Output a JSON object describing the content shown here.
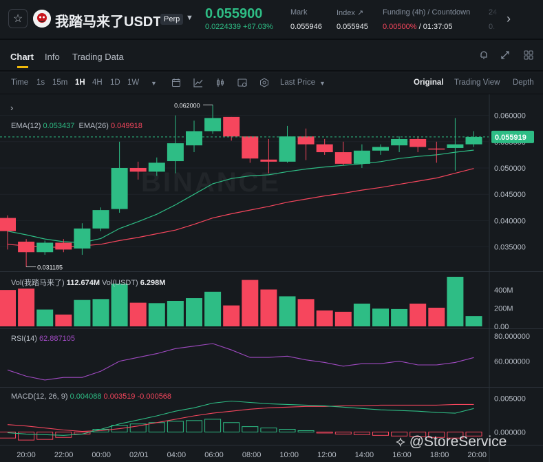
{
  "header": {
    "star_icon": "star-icon",
    "symbol": "我踏马来了USDT",
    "contract_badge": "Perp",
    "last_price": "0.055900",
    "change": "0.0224339 +67.03%",
    "stats": [
      {
        "label": "Mark",
        "value": "0.055946"
      },
      {
        "label": "Index ↗",
        "value": "0.055945"
      },
      {
        "label": "Funding (4h) / Countdown",
        "value_rate": "0.00500%",
        "value_countdown": " / 01:37:05"
      },
      {
        "label": "24",
        "value": "0."
      }
    ],
    "colors": {
      "up": "#2ebd85",
      "down": "#f6465d",
      "accent": "#f0b90b"
    }
  },
  "tabs": {
    "items": [
      "Chart",
      "Info",
      "Trading Data"
    ],
    "active": "Chart"
  },
  "toolbar": {
    "time_label": "Time",
    "intervals": [
      "1s",
      "15m",
      "1H",
      "4H",
      "1D",
      "1W"
    ],
    "active_interval": "1H",
    "price_type": "Last Price",
    "views": [
      "Original",
      "Trading View",
      "Depth"
    ],
    "active_view": "Original"
  },
  "chart": {
    "watermark": "BINANCE",
    "ema_legend": {
      "ema12_label": "EMA(12)",
      "ema12_value": "0.053437",
      "ema26_label": "EMA(26)",
      "ema26_value": "0.049918"
    },
    "vol_legend": {
      "label1": "Vol(我踏马来了)",
      "value1": "112.674M",
      "label2": "Vol(USDT)",
      "value2": "6.298M"
    },
    "rsi_legend": {
      "label": "RSI(14)",
      "value": "62.887105"
    },
    "macd_legend": {
      "label": "MACD(12, 26, 9)",
      "v1": "0.004088",
      "v2": "0.003519",
      "v3": "-0.000568"
    },
    "price_axis": [
      "0.060000",
      "0.055000",
      "0.050000",
      "0.045000",
      "0.040000",
      "0.035000"
    ],
    "current_price_tag": "0.055919",
    "high_label": "0.062000",
    "low_label": "0.031185",
    "vol_axis": [
      "400M",
      "200M",
      "0.00"
    ],
    "rsi_axis": [
      "80.000000",
      "60.000000"
    ],
    "macd_axis": [
      "0.005000",
      "0.000000"
    ],
    "time_axis": [
      "20:00",
      "22:00",
      "00:00",
      "02/01",
      "04:00",
      "06:00",
      "08:00",
      "10:00",
      "12:00",
      "14:00",
      "16:00",
      "18:00",
      "20:00"
    ]
  },
  "chart_data": {
    "type": "candlestick",
    "interval": "1H",
    "candles": [
      {
        "o": 0.0405,
        "h": 0.041,
        "c": 0.038,
        "l": 0.0345
      },
      {
        "o": 0.036,
        "h": 0.0365,
        "c": 0.034,
        "l": 0.0312
      },
      {
        "o": 0.034,
        "h": 0.0362,
        "c": 0.0358,
        "l": 0.0335
      },
      {
        "o": 0.0358,
        "h": 0.0365,
        "c": 0.0345,
        "l": 0.034
      },
      {
        "o": 0.0347,
        "h": 0.0395,
        "c": 0.0385,
        "l": 0.0335
      },
      {
        "o": 0.0385,
        "h": 0.0425,
        "c": 0.042,
        "l": 0.038
      },
      {
        "o": 0.0422,
        "h": 0.055,
        "c": 0.05,
        "l": 0.0415
      },
      {
        "o": 0.05,
        "h": 0.0512,
        "c": 0.0493,
        "l": 0.0478
      },
      {
        "o": 0.0493,
        "h": 0.052,
        "c": 0.051,
        "l": 0.0485
      },
      {
        "o": 0.0513,
        "h": 0.06,
        "c": 0.0547,
        "l": 0.049
      },
      {
        "o": 0.0543,
        "h": 0.059,
        "c": 0.057,
        "l": 0.053
      },
      {
        "o": 0.057,
        "h": 0.062,
        "c": 0.0595,
        "l": 0.0565
      },
      {
        "o": 0.0597,
        "h": 0.0597,
        "c": 0.056,
        "l": 0.0552
      },
      {
        "o": 0.056,
        "h": 0.056,
        "c": 0.0518,
        "l": 0.051
      },
      {
        "o": 0.0516,
        "h": 0.0555,
        "c": 0.0512,
        "l": 0.049
      },
      {
        "o": 0.0512,
        "h": 0.058,
        "c": 0.056,
        "l": 0.051
      },
      {
        "o": 0.056,
        "h": 0.0575,
        "c": 0.0545,
        "l": 0.0515
      },
      {
        "o": 0.0545,
        "h": 0.0555,
        "c": 0.053,
        "l": 0.0525
      },
      {
        "o": 0.053,
        "h": 0.055,
        "c": 0.0508,
        "l": 0.0505
      },
      {
        "o": 0.0508,
        "h": 0.0545,
        "c": 0.0533,
        "l": 0.05
      },
      {
        "o": 0.0533,
        "h": 0.0545,
        "c": 0.054,
        "l": 0.0525
      },
      {
        "o": 0.0543,
        "h": 0.056,
        "c": 0.0555,
        "l": 0.053
      },
      {
        "o": 0.0555,
        "h": 0.056,
        "c": 0.054,
        "l": 0.053
      },
      {
        "o": 0.0537,
        "h": 0.055,
        "c": 0.0535,
        "l": 0.051
      },
      {
        "o": 0.0538,
        "h": 0.0595,
        "c": 0.0545,
        "l": 0.0495
      },
      {
        "o": 0.0545,
        "h": 0.057,
        "c": 0.0559,
        "l": 0.054
      }
    ],
    "ema12": [
      0.038,
      0.0373,
      0.0365,
      0.036,
      0.0358,
      0.0366,
      0.0385,
      0.0398,
      0.0412,
      0.043,
      0.045,
      0.047,
      0.048,
      0.0485,
      0.0487,
      0.0493,
      0.0498,
      0.0502,
      0.0505,
      0.0508,
      0.0512,
      0.0518,
      0.0522,
      0.0525,
      0.053,
      0.0534
    ],
    "ema26": [
      0.0355,
      0.0352,
      0.035,
      0.0349,
      0.0352,
      0.0355,
      0.0362,
      0.0368,
      0.0375,
      0.0382,
      0.0393,
      0.0405,
      0.0413,
      0.042,
      0.0427,
      0.0435,
      0.0441,
      0.0447,
      0.0452,
      0.0458,
      0.0463,
      0.0469,
      0.0475,
      0.0481,
      0.049,
      0.0499
    ],
    "volume_millions": [
      400,
      415,
      185,
      130,
      290,
      300,
      470,
      260,
      255,
      280,
      310,
      380,
      230,
      510,
      405,
      330,
      300,
      175,
      160,
      250,
      195,
      190,
      250,
      205,
      545,
      112.674
    ],
    "rsi": [
      53,
      48,
      45,
      47,
      47,
      52,
      60,
      63,
      66,
      70,
      72,
      74,
      69,
      63,
      63,
      64,
      61,
      59,
      56,
      58,
      58,
      60,
      57,
      57,
      59,
      62.887105
    ],
    "macd_line": [
      -0.0001,
      -0.0003,
      -0.0004,
      -0.0005,
      -0.0003,
      0.0004,
      0.0012,
      0.0018,
      0.0024,
      0.0031,
      0.0036,
      0.0043,
      0.0046,
      0.0044,
      0.0042,
      0.0041,
      0.004,
      0.0039,
      0.0037,
      0.0035,
      0.0033,
      0.0032,
      0.0031,
      0.0029,
      0.0028,
      0.0035
    ],
    "signal_line": [
      0.0011,
      0.0009,
      0.0006,
      0.0003,
      0.0001,
      0.0002,
      0.0005,
      0.0009,
      0.0014,
      0.0019,
      0.0024,
      0.0028,
      0.0031,
      0.0034,
      0.0036,
      0.0037,
      0.0038,
      0.0038,
      0.0039,
      0.0039,
      0.004,
      0.004,
      0.004,
      0.004,
      0.0041,
      0.0041
    ],
    "histogram": [
      -0.0009,
      -0.0012,
      -0.0011,
      -0.0008,
      -0.0003,
      0.0004,
      0.001,
      0.0012,
      0.0014,
      0.0016,
      0.0017,
      0.0019,
      0.0014,
      0.0008,
      0.0006,
      0.0004,
      0.0002,
      -0.0001,
      -0.0003,
      -0.0004,
      -0.0005,
      -0.0006,
      -0.0007,
      -0.0008,
      -0.0009,
      -0.0006
    ],
    "price_range": [
      0.0305,
      0.064
    ],
    "volume_range": [
      0,
      560
    ],
    "rsi_range": [
      40,
      85
    ],
    "macd_range": [
      -0.0018,
      0.0065
    ]
  },
  "watermark_footer": "@StoreService"
}
